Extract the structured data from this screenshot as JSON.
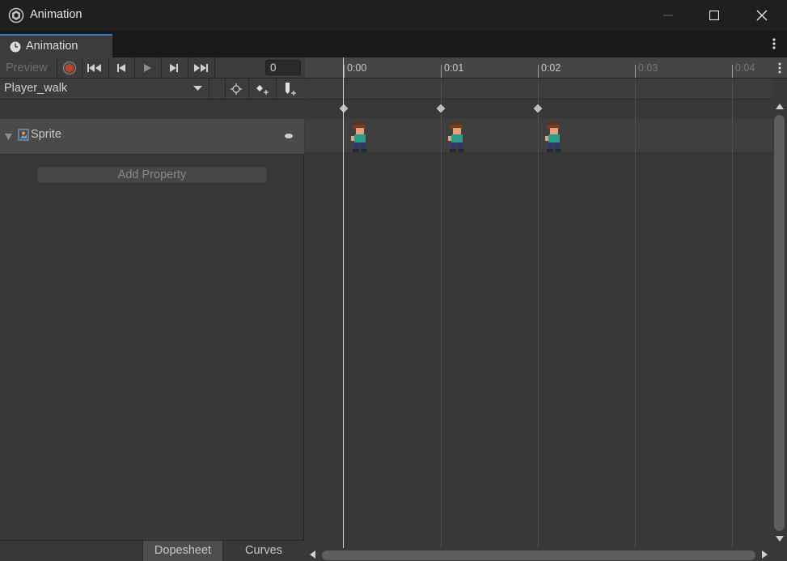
{
  "window": {
    "title": "Animation",
    "icons": {
      "app": "unity-cube-icon",
      "minimize": "minimize-icon",
      "maximize": "maximize-icon",
      "close": "close-icon"
    }
  },
  "tab": {
    "label": "Animation",
    "icon": "clock-icon"
  },
  "toolbar": {
    "preview_label": "Preview",
    "frame_value": "0",
    "buttons": [
      "record-icon",
      "first-keyframe-icon",
      "prev-keyframe-icon",
      "play-icon",
      "next-keyframe-icon",
      "last-keyframe-icon"
    ]
  },
  "clip": {
    "name": "Player_walk",
    "tools": [
      "keyframe-filter-icon",
      "add-keyframe-icon",
      "add-event-icon"
    ]
  },
  "properties": [
    {
      "label": "Sprite",
      "icon": "sprite-icon"
    }
  ],
  "add_property_label": "Add Property",
  "view_tabs": {
    "dopesheet": "Dopesheet",
    "curves": "Curves",
    "active": "Dopesheet"
  },
  "timeline": {
    "ruler_labels": [
      "0:00",
      "0:01",
      "0:02",
      "0:03",
      "0:04"
    ],
    "out_of_range_from_index": 3,
    "keyframes": [
      "0:00",
      "0:01",
      "0:02"
    ],
    "playhead": "0:00"
  },
  "colors": {
    "record": "#b4452f",
    "tab_accent": "#3a79bb",
    "ruler_text_active": "#c8c8c8",
    "ruler_text_inactive": "#777777"
  }
}
